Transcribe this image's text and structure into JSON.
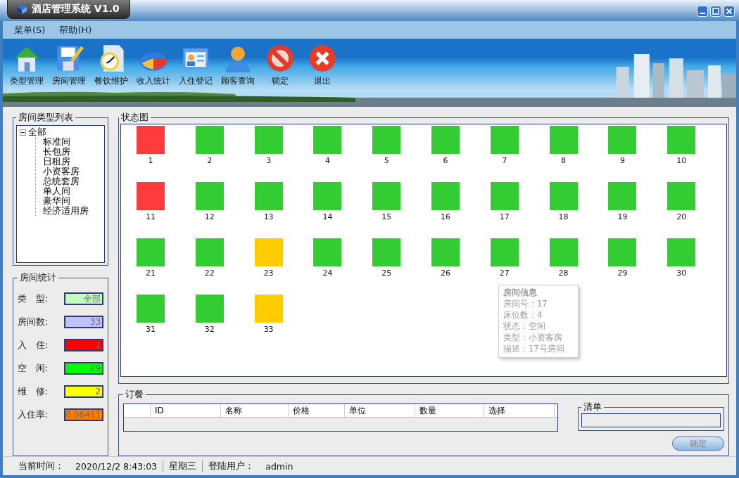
{
  "window": {
    "title": "酒店管理系统 V1.0"
  },
  "menu": [
    {
      "label": "菜单(S)"
    },
    {
      "label": "帮助(H)"
    }
  ],
  "toolbar": [
    {
      "label": "类型管理",
      "kind": "house"
    },
    {
      "label": "房间管理",
      "kind": "floppy"
    },
    {
      "label": "餐饮维护",
      "kind": "clock"
    },
    {
      "label": "收入统计",
      "kind": "pie"
    },
    {
      "label": "入住登记",
      "kind": "card"
    },
    {
      "label": "顾客查询",
      "kind": "person"
    },
    {
      "label": "锁定",
      "kind": "forbid"
    },
    {
      "label": "退出",
      "kind": "close"
    }
  ],
  "room_types": {
    "title": "房间类型列表",
    "tree": [
      {
        "label": "全部",
        "expanded": true,
        "children": [
          {
            "label": "标准间"
          },
          {
            "label": "长包房"
          },
          {
            "label": "日租房"
          },
          {
            "label": "小资客房"
          },
          {
            "label": "总统套房"
          },
          {
            "label": "单人间"
          },
          {
            "label": "豪华间"
          },
          {
            "label": "经济适用房"
          }
        ]
      }
    ]
  },
  "stats": {
    "title": "房间统计",
    "items": [
      {
        "label": "类　型:",
        "value": "全部",
        "color": "#c0ffc0"
      },
      {
        "label": "房间数:",
        "value": "33",
        "color": "#c0c0ff"
      },
      {
        "label": "入　住:",
        "value": "2",
        "color": "#ff0000"
      },
      {
        "label": "空　闲:",
        "value": "29",
        "color": "#00ff00"
      },
      {
        "label": "维　修:",
        "value": "2",
        "color": "#ffff00"
      },
      {
        "label": "入住率:",
        "value": "0.06451",
        "color": "#ff8000"
      }
    ]
  },
  "status_map": {
    "title": "状态图",
    "rooms": [
      {
        "number": "1",
        "color": "#ff3b3b"
      },
      {
        "number": "2",
        "color": "#33cc33"
      },
      {
        "number": "3",
        "color": "#33cc33"
      },
      {
        "number": "4",
        "color": "#33cc33"
      },
      {
        "number": "5",
        "color": "#33cc33"
      },
      {
        "number": "6",
        "color": "#33cc33"
      },
      {
        "number": "7",
        "color": "#33cc33"
      },
      {
        "number": "8",
        "color": "#33cc33"
      },
      {
        "number": "9",
        "color": "#33cc33"
      },
      {
        "number": "10",
        "color": "#33cc33"
      },
      {
        "number": "11",
        "color": "#ff3b3b"
      },
      {
        "number": "12",
        "color": "#33cc33"
      },
      {
        "number": "13",
        "color": "#33cc33"
      },
      {
        "number": "14",
        "color": "#33cc33"
      },
      {
        "number": "15",
        "color": "#33cc33"
      },
      {
        "number": "16",
        "color": "#33cc33"
      },
      {
        "number": "17",
        "color": "#33cc33"
      },
      {
        "number": "18",
        "color": "#33cc33"
      },
      {
        "number": "19",
        "color": "#33cc33"
      },
      {
        "number": "20",
        "color": "#33cc33"
      },
      {
        "number": "21",
        "color": "#33cc33"
      },
      {
        "number": "22",
        "color": "#33cc33"
      },
      {
        "number": "23",
        "color": "#ffcc00"
      },
      {
        "number": "24",
        "color": "#33cc33"
      },
      {
        "number": "25",
        "color": "#33cc33"
      },
      {
        "number": "26",
        "color": "#33cc33"
      },
      {
        "number": "27",
        "color": "#33cc33"
      },
      {
        "number": "28",
        "color": "#33cc33"
      },
      {
        "number": "29",
        "color": "#33cc33"
      },
      {
        "number": "30",
        "color": "#33cc33"
      },
      {
        "number": "31",
        "color": "#33cc33"
      },
      {
        "number": "32",
        "color": "#33cc33"
      },
      {
        "number": "33",
        "color": "#ffcc00"
      }
    ],
    "tooltip": {
      "title": "房间信息",
      "lines": [
        "房间号：17",
        "床位数：4",
        "状态：空闲",
        "类型：小资客房",
        "描述：17号房间"
      ]
    }
  },
  "order": {
    "title": "订餐",
    "columns": [
      "ID",
      "名称",
      "价格",
      "单位",
      "数量",
      "选择"
    ]
  },
  "bill": {
    "title": "清单"
  },
  "confirm_button": {
    "label": "确定",
    "disabled": true
  },
  "status_bar": [
    "当前时间：",
    "2020/12/2 8:43:03",
    "星期三",
    "登陆用户：",
    "admin"
  ]
}
